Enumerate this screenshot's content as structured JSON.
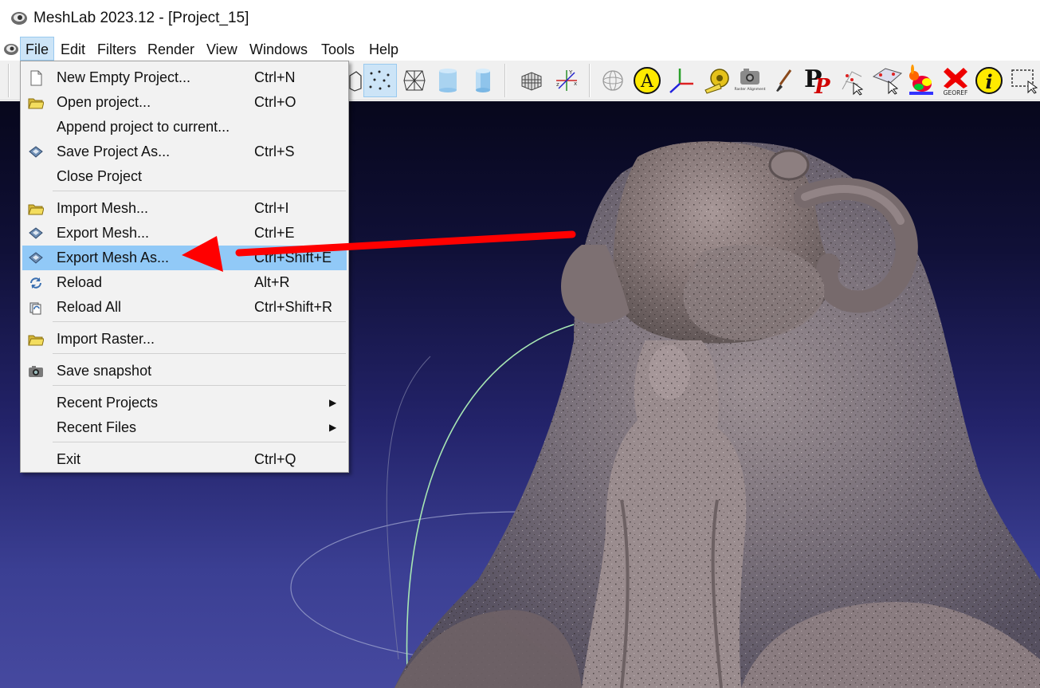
{
  "window": {
    "title": "MeshLab 2023.12 - [Project_15]"
  },
  "menubar": {
    "items": [
      {
        "label": "File",
        "active": true
      },
      {
        "label": "Edit"
      },
      {
        "label": "Filters"
      },
      {
        "label": "Render"
      },
      {
        "label": "View"
      },
      {
        "label": "Windows"
      },
      {
        "label": "Tools"
      },
      {
        "label": "Help"
      }
    ]
  },
  "toolbar": {
    "raster_alignment_label": "Raster Alignment",
    "georef_label": "GEOREF",
    "icons": [
      "box-icon",
      "bbox-icon",
      "points-icon",
      "wireframe-icon",
      "flat-cylinder-icon",
      "smooth-cylinder-icon",
      "grid-icon",
      "axes-icon",
      "sphere-icon",
      "annotation-icon",
      "frame-axes-icon",
      "measure-tape-icon",
      "raster-alignment-icon",
      "paint-brush-icon",
      "pickpoints-icon",
      "select-vertices-icon",
      "select-connected-icon",
      "bunny-quality-icon",
      "georef-icon",
      "info-icon",
      "select-rect-icon"
    ]
  },
  "file_menu": {
    "items": [
      {
        "label": "New Empty Project...",
        "shortcut": "Ctrl+N",
        "icon": "new-file-icon"
      },
      {
        "label": "Open project...",
        "shortcut": "Ctrl+O",
        "icon": "folder-icon"
      },
      {
        "label": "Append project to current...",
        "shortcut": "",
        "icon": ""
      },
      {
        "label": "Save Project As...",
        "shortcut": "Ctrl+S",
        "icon": "save-disk-icon"
      },
      {
        "label": "Close Project",
        "shortcut": "",
        "icon": ""
      },
      {
        "label": "Import Mesh...",
        "shortcut": "Ctrl+I",
        "icon": "folder-icon"
      },
      {
        "label": "Export Mesh...",
        "shortcut": "Ctrl+E",
        "icon": "save-disk-icon"
      },
      {
        "label": "Export Mesh As...",
        "shortcut": "Ctrl+Shift+E",
        "icon": "save-disk-icon",
        "highlighted": true
      },
      {
        "label": "Reload",
        "shortcut": "Alt+R",
        "icon": "reload-icon"
      },
      {
        "label": "Reload All",
        "shortcut": "Ctrl+Shift+R",
        "icon": "reload-all-icon"
      },
      {
        "label": "Import Raster...",
        "shortcut": "",
        "icon": "folder-icon"
      },
      {
        "label": "Save snapshot",
        "shortcut": "",
        "icon": "camera-icon"
      },
      {
        "label": "Recent Projects",
        "shortcut": "",
        "icon": "",
        "submenu": true
      },
      {
        "label": "Recent Files",
        "shortcut": "",
        "icon": "",
        "submenu": true
      },
      {
        "label": "Exit",
        "shortcut": "Ctrl+Q",
        "icon": ""
      }
    ]
  },
  "colors": {
    "menu_highlight": "#91c9f7",
    "annotation_arrow": "#ff0000",
    "viewport_top": "#07071c",
    "viewport_bottom": "#46499f"
  }
}
